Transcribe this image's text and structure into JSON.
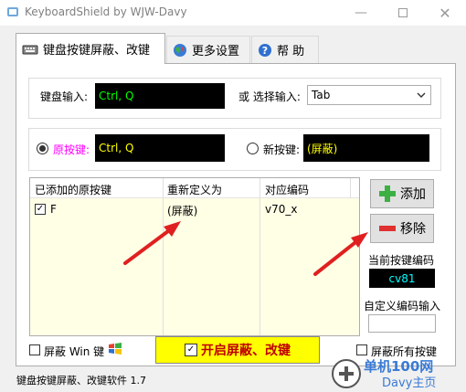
{
  "window": {
    "title": "KeyboardShield by WJW-Davy"
  },
  "tabs": [
    {
      "label": "键盘按键屏蔽、改键",
      "icon": "keyboard-icon"
    },
    {
      "label": "更多设置",
      "icon": "globe-icon"
    },
    {
      "label": "帮 助",
      "icon": "help-icon"
    }
  ],
  "keyboard_input": {
    "label": "键盘输入:",
    "value": "Ctrl, Q"
  },
  "select_input": {
    "label": "或 选择输入:",
    "selected": "Tab"
  },
  "original_key": {
    "label": "原按键:",
    "value": "Ctrl, Q"
  },
  "new_key": {
    "label": "新按键:",
    "value": "(屏蔽)"
  },
  "list": {
    "columns": [
      "已添加的原按键",
      "重新定义为",
      "对应编码"
    ],
    "rows": [
      {
        "checked": true,
        "original": "F",
        "redefined": "(屏蔽)",
        "code": "v70_x"
      }
    ]
  },
  "buttons": {
    "add": "添加",
    "remove": "移除",
    "start": "开启屏蔽、改键"
  },
  "current_code": {
    "label": "当前按键编码",
    "value": "cv81"
  },
  "custom_code": {
    "label": "自定义编码输入",
    "value": ""
  },
  "options": {
    "block_win": "屏蔽 Win 键",
    "block_all": "屏蔽所有按键"
  },
  "status_bar": {
    "text": "键盘按键屏蔽、改键软件 1.7"
  },
  "watermark": {
    "text": "单机100网",
    "link": "Davy主页"
  },
  "colors": {
    "green_text": "#00ff00",
    "yellow_text": "#ffff00",
    "cyan_text": "#00ffff",
    "magenta_label": "#ff00ff",
    "arrow_red": "#e02020",
    "start_bg": "#ffff00"
  }
}
